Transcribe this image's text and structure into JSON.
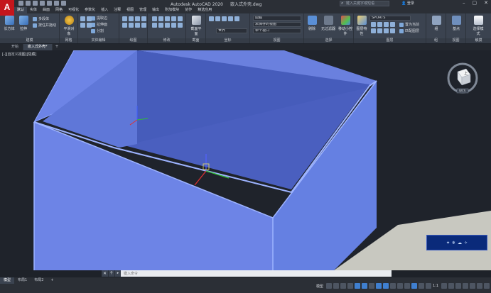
{
  "app": {
    "logo": "A",
    "title": "Autodesk AutoCAD 2020",
    "file": "嵌入式外壳.dwg",
    "search_placeholder": "键入关键字或短语",
    "login": "登录"
  },
  "ribbon_tabs": [
    "默认",
    "实体",
    "曲面",
    "网格",
    "可视化",
    "参数化",
    "插入",
    "注释",
    "视图",
    "管理",
    "输出",
    "附加模块",
    "协作",
    "精选应用"
  ],
  "ribbon": {
    "modeling": {
      "title": "建模",
      "box_label": "长方体",
      "extrude_label": "拉伸",
      "smooth_label": "平滑对象",
      "items": [
        "多段体",
        "按住并拖动"
      ]
    },
    "mesh": {
      "title": "网格"
    },
    "solid_edit": {
      "title": "实体编辑",
      "items": [
        "提取边",
        "拉伸面",
        "分割"
      ]
    },
    "draw": {
      "title": "绘图"
    },
    "modify": {
      "title": "修改"
    },
    "section": {
      "title": "截面",
      "plane_label": "截面平面"
    },
    "coordinates": {
      "title": "坐标",
      "world": "世界"
    },
    "view": {
      "title": "视图",
      "visual_style": "隐藏",
      "unsaved_view": "未保存的视图",
      "single_viewport": "单个视口"
    },
    "select": {
      "title": "选择",
      "culling_label": "剔除",
      "no_filter": "无过滤器"
    },
    "gizmo": {
      "label": "移动小控件"
    },
    "layers": {
      "title": "图层",
      "layer_props": "图层特性",
      "layer_name": "SPORTS",
      "match": "置为当前",
      "match_layer": "匹配图层"
    },
    "groups": {
      "title": "组",
      "label": "组"
    },
    "view_panel": {
      "title": "视图",
      "label": "基点"
    },
    "touch": {
      "title": "触摸",
      "label": "选择模式"
    }
  },
  "file_tabs": [
    "开始",
    "嵌入式外壳*"
  ],
  "viewport": {
    "label": "[-][自定义视图][隐藏]",
    "viewcube_face": "上",
    "wcs": "WCS"
  },
  "command": {
    "placeholder": "键入命令"
  },
  "layout_tabs": [
    "模型",
    "布局1",
    "布局2"
  ],
  "status": {
    "model": "模型",
    "scale": "1:1"
  },
  "colors": {
    "accent": "#3f7fd0",
    "solid": "#6b86e8",
    "background": "#1f232b"
  }
}
